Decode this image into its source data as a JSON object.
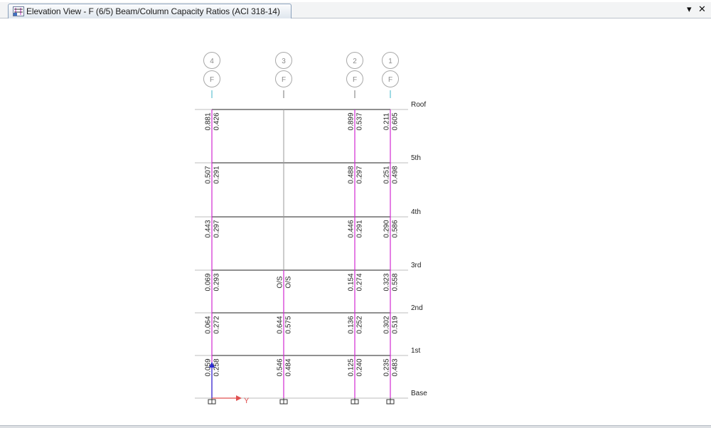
{
  "tab": {
    "title": "Elevation View - F  (6/5) Beam/Column Capacity Ratios  (ACI 318-14)"
  },
  "window_controls": {
    "dropdown": "▾",
    "close": "✕"
  },
  "elevation": {
    "grid_letter": "F",
    "grid_lines": [
      "4",
      "3",
      "2",
      "1"
    ],
    "stories": [
      "Roof",
      "5th",
      "4th",
      "3rd",
      "2nd",
      "1st",
      "Base"
    ],
    "axis_label": "Y",
    "colors": {
      "column": "#d12ad1",
      "beam": "#222222",
      "grid": "#9a9a9a",
      "text": "#222222",
      "axis": "#e05050",
      "axis_z": "#2b2bd0",
      "grid_marker": "#3fb4c8"
    },
    "ratios": {
      "4": [
        [
          "0.881",
          "0.426"
        ],
        [
          "0.507",
          "0.291"
        ],
        [
          "0.443",
          "0.297"
        ],
        [
          "0.069",
          "0.293"
        ],
        [
          "0.064",
          "0.272"
        ],
        [
          "0.059",
          "0.258"
        ]
      ],
      "3": [
        [
          "",
          ""
        ],
        [
          "",
          ""
        ],
        [
          "",
          ""
        ],
        [
          "O/S",
          "O/S"
        ],
        [
          "0.644",
          "0.575"
        ],
        [
          "0.546",
          "0.484"
        ]
      ],
      "2": [
        [
          "0.899",
          "0.537"
        ],
        [
          "0.488",
          "0.297"
        ],
        [
          "0.446",
          "0.291"
        ],
        [
          "0.154",
          "0.274"
        ],
        [
          "0.136",
          "0.252"
        ],
        [
          "0.125",
          "0.240"
        ]
      ],
      "1": [
        [
          "0.211",
          "0.605"
        ],
        [
          "0.251",
          "0.498"
        ],
        [
          "0.290",
          "0.586"
        ],
        [
          "0.323",
          "0.558"
        ],
        [
          "0.302",
          "0.519"
        ],
        [
          "0.235",
          "0.483"
        ]
      ]
    }
  }
}
